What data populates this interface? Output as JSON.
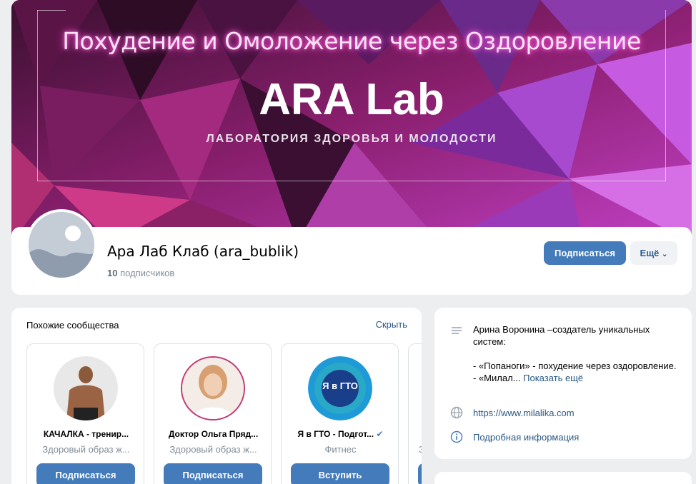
{
  "cover": {
    "title": "Похудение и Омоложение через Оздоровление",
    "brand": "ARA Lab",
    "tagline": "ЛАБОРАТОРИЯ ЗДОРОВЬЯ И МОЛОДОСТИ"
  },
  "header": {
    "group_name": "Ара Лаб Клаб (ara_bublik)",
    "subscribers_count": "10",
    "subscribers_label": "подписчиков",
    "subscribe_label": "Подписаться",
    "more_label": "Ещё"
  },
  "similar": {
    "title": "Похожие сообщества",
    "hide_label": "Скрыть",
    "items": [
      {
        "name": "КАЧАЛКА - тренир...",
        "desc": "Здоровый образ ж...",
        "button": "Подписаться"
      },
      {
        "name": "Доктор Ольга Пряд...",
        "desc": "Здоровый образ ж...",
        "button": "Подписаться"
      },
      {
        "name": "Я в ГТО - Подгот...",
        "desc": "Фитнес",
        "button": "Вступить",
        "badge": "Я в ГТО"
      },
      {
        "name": "",
        "desc": "З",
        "button": ""
      }
    ]
  },
  "about": {
    "line1": "Арина Воронина –создатель уникальных систем:",
    "line2": "- «Попаноги» - похудение через оздоровление.",
    "line3": "- «Милал...",
    "show_more": "Показать ещё",
    "website": "https://www.milalika.com",
    "details": "Подробная информация"
  },
  "colors": {
    "accent": "#447bba",
    "link": "#2a5885",
    "muted": "#818c99",
    "background": "#edeef0"
  }
}
